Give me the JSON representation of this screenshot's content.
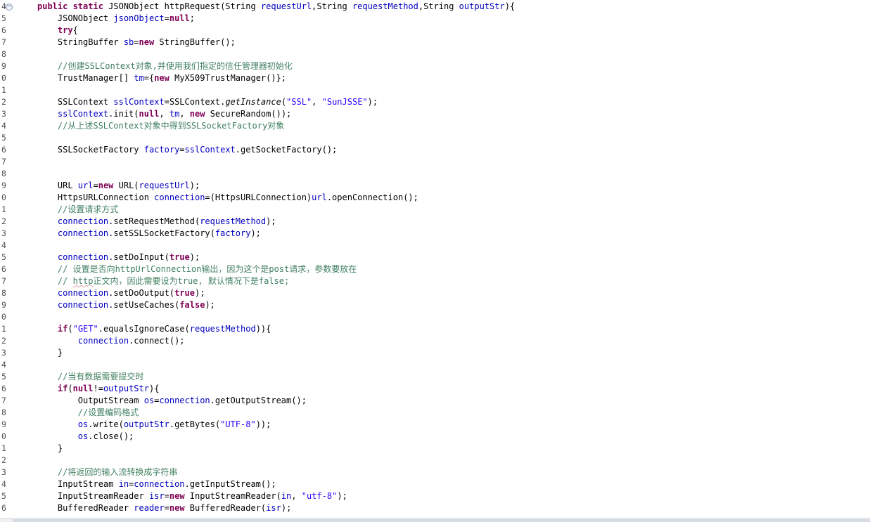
{
  "editor": {
    "colors": {
      "background": "#ffffff",
      "keyword": "#7f0055",
      "field": "#0000c0",
      "string": "#2a00ff",
      "comment": "#3f7f5f",
      "line_number": "#505050"
    },
    "fold_icon": "collapse-minus-icon",
    "line_numbers": [
      "4",
      "5",
      "6",
      "7",
      "8",
      "9",
      "0",
      "1",
      "2",
      "3",
      "4",
      "5",
      "6",
      "7",
      "8",
      "9",
      "0",
      "1",
      "2",
      "3",
      "4",
      "5",
      "6",
      "7",
      "8",
      "9",
      "0",
      "1",
      "2",
      "3",
      "4",
      "5",
      "6",
      "7",
      "8",
      "9",
      "0",
      "1",
      "2",
      "3",
      "4",
      "5",
      "6"
    ],
    "lines": [
      [
        {
          "t": "public static ",
          "c": "kw"
        },
        {
          "t": "JSONObject httpRequest(String "
        },
        {
          "t": "requestUrl",
          "c": "fld"
        },
        {
          "t": ",String "
        },
        {
          "t": "requestMethod",
          "c": "fld"
        },
        {
          "t": ",String "
        },
        {
          "t": "outputStr",
          "c": "fld"
        },
        {
          "t": "){"
        }
      ],
      [
        {
          "t": "    JSONObject "
        },
        {
          "t": "jsonObject",
          "c": "fld"
        },
        {
          "t": "="
        },
        {
          "t": "null",
          "c": "kw"
        },
        {
          "t": ";"
        }
      ],
      [
        {
          "t": "    "
        },
        {
          "t": "try",
          "c": "kw"
        },
        {
          "t": "{"
        }
      ],
      [
        {
          "t": "    StringBuffer "
        },
        {
          "t": "sb",
          "c": "fld"
        },
        {
          "t": "="
        },
        {
          "t": "new ",
          "c": "kw"
        },
        {
          "t": "StringBuffer();"
        }
      ],
      [],
      [
        {
          "t": "    "
        },
        {
          "t": "//创建SSLContext对象,并使用我们指定的信任管理器初始化",
          "c": "cmt"
        }
      ],
      [
        {
          "t": "    TrustManager[] "
        },
        {
          "t": "tm",
          "c": "fld"
        },
        {
          "t": "={"
        },
        {
          "t": "new ",
          "c": "kw"
        },
        {
          "t": "MyX509TrustManager()};"
        }
      ],
      [],
      [
        {
          "t": "    SSLContext "
        },
        {
          "t": "sslContext",
          "c": "fld"
        },
        {
          "t": "=SSLContext."
        },
        {
          "t": "getInstance",
          "c": "it"
        },
        {
          "t": "("
        },
        {
          "t": "\"SSL\"",
          "c": "str"
        },
        {
          "t": ", "
        },
        {
          "t": "\"SunJSSE\"",
          "c": "str"
        },
        {
          "t": ");"
        }
      ],
      [
        {
          "t": "    "
        },
        {
          "t": "sslContext",
          "c": "fld"
        },
        {
          "t": ".init("
        },
        {
          "t": "null",
          "c": "kw"
        },
        {
          "t": ", "
        },
        {
          "t": "tm",
          "c": "fld"
        },
        {
          "t": ", "
        },
        {
          "t": "new ",
          "c": "kw"
        },
        {
          "t": "SecureRandom());"
        }
      ],
      [
        {
          "t": "    "
        },
        {
          "t": "//从上述SSLContext对象中得到SSLSocketFactory对象",
          "c": "cmt"
        }
      ],
      [],
      [
        {
          "t": "    SSLSocketFactory "
        },
        {
          "t": "factory",
          "c": "fld"
        },
        {
          "t": "="
        },
        {
          "t": "sslContext",
          "c": "fld"
        },
        {
          "t": ".getSocketFactory();"
        }
      ],
      [],
      [],
      [
        {
          "t": "    URL "
        },
        {
          "t": "url",
          "c": "fld"
        },
        {
          "t": "="
        },
        {
          "t": "new ",
          "c": "kw"
        },
        {
          "t": "URL("
        },
        {
          "t": "requestUrl",
          "c": "fld"
        },
        {
          "t": ");"
        }
      ],
      [
        {
          "t": "    HttpsURLConnection "
        },
        {
          "t": "connection",
          "c": "fld"
        },
        {
          "t": "=(HttpsURLConnection)"
        },
        {
          "t": "url",
          "c": "fld"
        },
        {
          "t": ".openConnection();"
        }
      ],
      [
        {
          "t": "    "
        },
        {
          "t": "//设置请求方式",
          "c": "cmt"
        }
      ],
      [
        {
          "t": "    "
        },
        {
          "t": "connection",
          "c": "fld"
        },
        {
          "t": ".setRequestMethod("
        },
        {
          "t": "requestMethod",
          "c": "fld"
        },
        {
          "t": ");"
        }
      ],
      [
        {
          "t": "    "
        },
        {
          "t": "connection",
          "c": "fld"
        },
        {
          "t": ".setSSLSocketFactory("
        },
        {
          "t": "factory",
          "c": "fld"
        },
        {
          "t": ");"
        }
      ],
      [],
      [
        {
          "t": "    "
        },
        {
          "t": "connection",
          "c": "fld"
        },
        {
          "t": ".setDoInput("
        },
        {
          "t": "true",
          "c": "kw"
        },
        {
          "t": ");"
        }
      ],
      [
        {
          "t": "    "
        },
        {
          "t": "// 设置是否向httpUrlConnection输出，因为这个是post请求，参数要放在",
          "c": "cmt"
        }
      ],
      [
        {
          "t": "    "
        },
        {
          "t": "// ",
          "c": "cmt"
        },
        {
          "t": "http",
          "c": "cmt err"
        },
        {
          "t": "正文内，因此需要设为true, 默认情况下是false;",
          "c": "cmt"
        }
      ],
      [
        {
          "t": "    "
        },
        {
          "t": "connection",
          "c": "fld"
        },
        {
          "t": ".setDoOutput("
        },
        {
          "t": "true",
          "c": "kw"
        },
        {
          "t": ");"
        }
      ],
      [
        {
          "t": "    "
        },
        {
          "t": "connection",
          "c": "fld"
        },
        {
          "t": ".setUseCaches("
        },
        {
          "t": "false",
          "c": "kw"
        },
        {
          "t": ");"
        }
      ],
      [],
      [
        {
          "t": "    "
        },
        {
          "t": "if",
          "c": "kw"
        },
        {
          "t": "("
        },
        {
          "t": "\"GET\"",
          "c": "str"
        },
        {
          "t": ".equalsIgnoreCase("
        },
        {
          "t": "requestMethod",
          "c": "fld"
        },
        {
          "t": ")){"
        }
      ],
      [
        {
          "t": "        "
        },
        {
          "t": "connection",
          "c": "fld"
        },
        {
          "t": ".connect();"
        }
      ],
      [
        {
          "t": "    }"
        }
      ],
      [],
      [
        {
          "t": "    "
        },
        {
          "t": "//当有数据需要提交时",
          "c": "cmt"
        }
      ],
      [
        {
          "t": "    "
        },
        {
          "t": "if",
          "c": "kw"
        },
        {
          "t": "("
        },
        {
          "t": "null",
          "c": "kw"
        },
        {
          "t": "!="
        },
        {
          "t": "outputStr",
          "c": "fld"
        },
        {
          "t": "){"
        }
      ],
      [
        {
          "t": "        OutputStream "
        },
        {
          "t": "os",
          "c": "fld"
        },
        {
          "t": "="
        },
        {
          "t": "connection",
          "c": "fld"
        },
        {
          "t": ".getOutputStream();"
        }
      ],
      [
        {
          "t": "        "
        },
        {
          "t": "//设置编码格式",
          "c": "cmt"
        }
      ],
      [
        {
          "t": "        "
        },
        {
          "t": "os",
          "c": "fld"
        },
        {
          "t": ".write("
        },
        {
          "t": "outputStr",
          "c": "fld"
        },
        {
          "t": ".getBytes("
        },
        {
          "t": "\"UTF-8\"",
          "c": "str"
        },
        {
          "t": "));"
        }
      ],
      [
        {
          "t": "        "
        },
        {
          "t": "os",
          "c": "fld"
        },
        {
          "t": ".close();"
        }
      ],
      [
        {
          "t": "    }"
        }
      ],
      [],
      [
        {
          "t": "    "
        },
        {
          "t": "//将返回的输入流转换成字符串",
          "c": "cmt"
        }
      ],
      [
        {
          "t": "    InputStream "
        },
        {
          "t": "in",
          "c": "fld"
        },
        {
          "t": "="
        },
        {
          "t": "connection",
          "c": "fld"
        },
        {
          "t": ".getInputStream();"
        }
      ],
      [
        {
          "t": "    InputStreamReader "
        },
        {
          "t": "isr",
          "c": "fld"
        },
        {
          "t": "="
        },
        {
          "t": "new ",
          "c": "kw"
        },
        {
          "t": "InputStreamReader("
        },
        {
          "t": "in",
          "c": "fld"
        },
        {
          "t": ", "
        },
        {
          "t": "\"utf-8\"",
          "c": "str"
        },
        {
          "t": ");"
        }
      ],
      [
        {
          "t": "    BufferedReader "
        },
        {
          "t": "reader",
          "c": "fld"
        },
        {
          "t": "="
        },
        {
          "t": "new ",
          "c": "kw"
        },
        {
          "t": "BufferedReader("
        },
        {
          "t": "isr",
          "c": "fld"
        },
        {
          "t": ");"
        }
      ]
    ]
  }
}
